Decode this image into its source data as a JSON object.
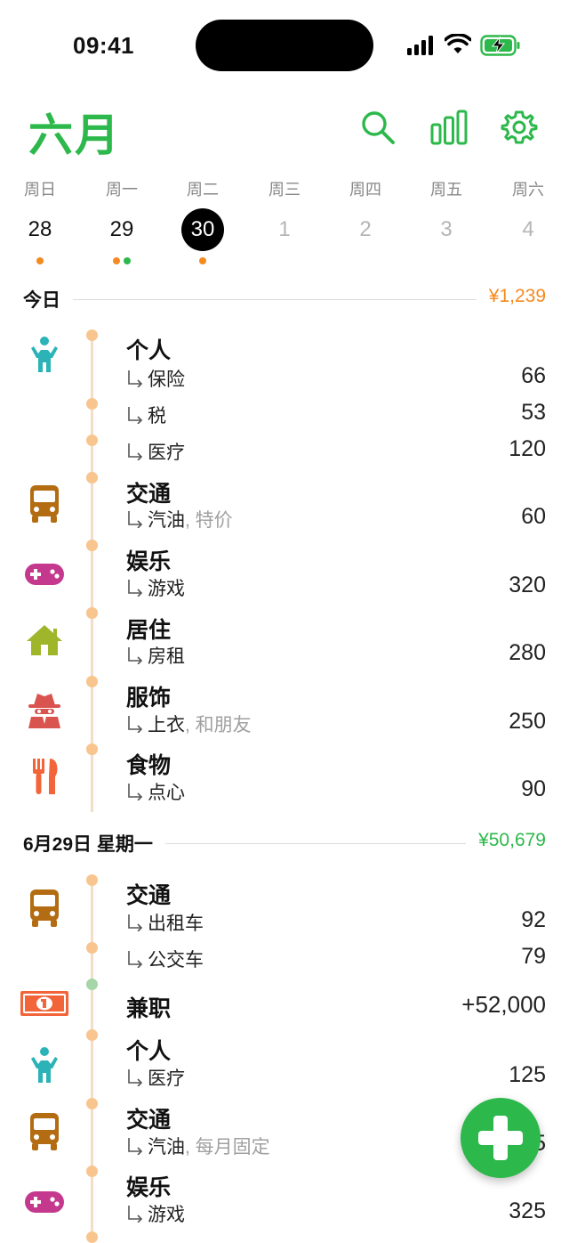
{
  "status_bar": {
    "time": "09:41"
  },
  "header": {
    "title": "六月"
  },
  "week": [
    {
      "weekday": "周日",
      "date": "28",
      "state": "normal",
      "dots": [
        "#f58a1f"
      ]
    },
    {
      "weekday": "周一",
      "date": "29",
      "state": "normal",
      "dots": [
        "#f58a1f",
        "#2db84b"
      ]
    },
    {
      "weekday": "周二",
      "date": "30",
      "state": "selected",
      "dots": [
        "#f58a1f"
      ]
    },
    {
      "weekday": "周三",
      "date": "1",
      "state": "dim",
      "dots": []
    },
    {
      "weekday": "周四",
      "date": "2",
      "state": "dim",
      "dots": []
    },
    {
      "weekday": "周五",
      "date": "3",
      "state": "dim",
      "dots": []
    },
    {
      "weekday": "周六",
      "date": "4",
      "state": "dim",
      "dots": []
    }
  ],
  "sections": [
    {
      "label": "今日",
      "total": "¥1,239",
      "total_color": "#f58a1f",
      "groups": [
        {
          "category": "个人",
          "icon": "person-icon",
          "items": [
            {
              "name": "保险",
              "note": "",
              "amount": "66"
            },
            {
              "name": "税",
              "note": "",
              "amount": "53"
            },
            {
              "name": "医疗",
              "note": "",
              "amount": "120"
            }
          ]
        },
        {
          "category": "交通",
          "icon": "bus-icon",
          "items": [
            {
              "name": "汽油",
              "note": ", 特价",
              "amount": "60"
            }
          ]
        },
        {
          "category": "娱乐",
          "icon": "gamepad-icon",
          "items": [
            {
              "name": "游戏",
              "note": "",
              "amount": "320"
            }
          ]
        },
        {
          "category": "居住",
          "icon": "house-icon",
          "items": [
            {
              "name": "房租",
              "note": "",
              "amount": "280"
            }
          ]
        },
        {
          "category": "服饰",
          "icon": "spy-icon",
          "items": [
            {
              "name": "上衣",
              "note": ", 和朋友",
              "amount": "250"
            }
          ]
        },
        {
          "category": "食物",
          "icon": "utensils-icon",
          "items": [
            {
              "name": "点心",
              "note": "",
              "amount": "90"
            }
          ]
        }
      ]
    },
    {
      "label": "6月29日 星期一",
      "total": "¥50,679",
      "total_color": "#2db84b",
      "groups": [
        {
          "category": "交通",
          "icon": "bus-icon",
          "items": [
            {
              "name": "出租车",
              "note": "",
              "amount": "92"
            },
            {
              "name": "公交车",
              "note": "",
              "amount": "79"
            }
          ]
        },
        {
          "category": "兼职",
          "icon": "money-bill-icon",
          "income": true,
          "amount": "+52,000",
          "items": []
        },
        {
          "category": "个人",
          "icon": "person-icon",
          "items": [
            {
              "name": "医疗",
              "note": "",
              "amount": "125"
            }
          ]
        },
        {
          "category": "交通",
          "icon": "bus-icon",
          "items": [
            {
              "name": "汽油",
              "note": ", 每月固定",
              "amount": "65"
            }
          ]
        },
        {
          "category": "娱乐",
          "icon": "gamepad-icon",
          "items": [
            {
              "name": "游戏",
              "note": "",
              "amount": "325"
            }
          ]
        }
      ]
    }
  ],
  "colors": {
    "accent": "#2db84b",
    "expense": "#f58a1f",
    "timeline_dot": "#f8c58f",
    "timeline_line": "#f3ddc9"
  },
  "icons": {
    "search": "search-icon",
    "stats": "bar-chart-icon",
    "settings": "gear-icon",
    "add": "plus-icon"
  }
}
